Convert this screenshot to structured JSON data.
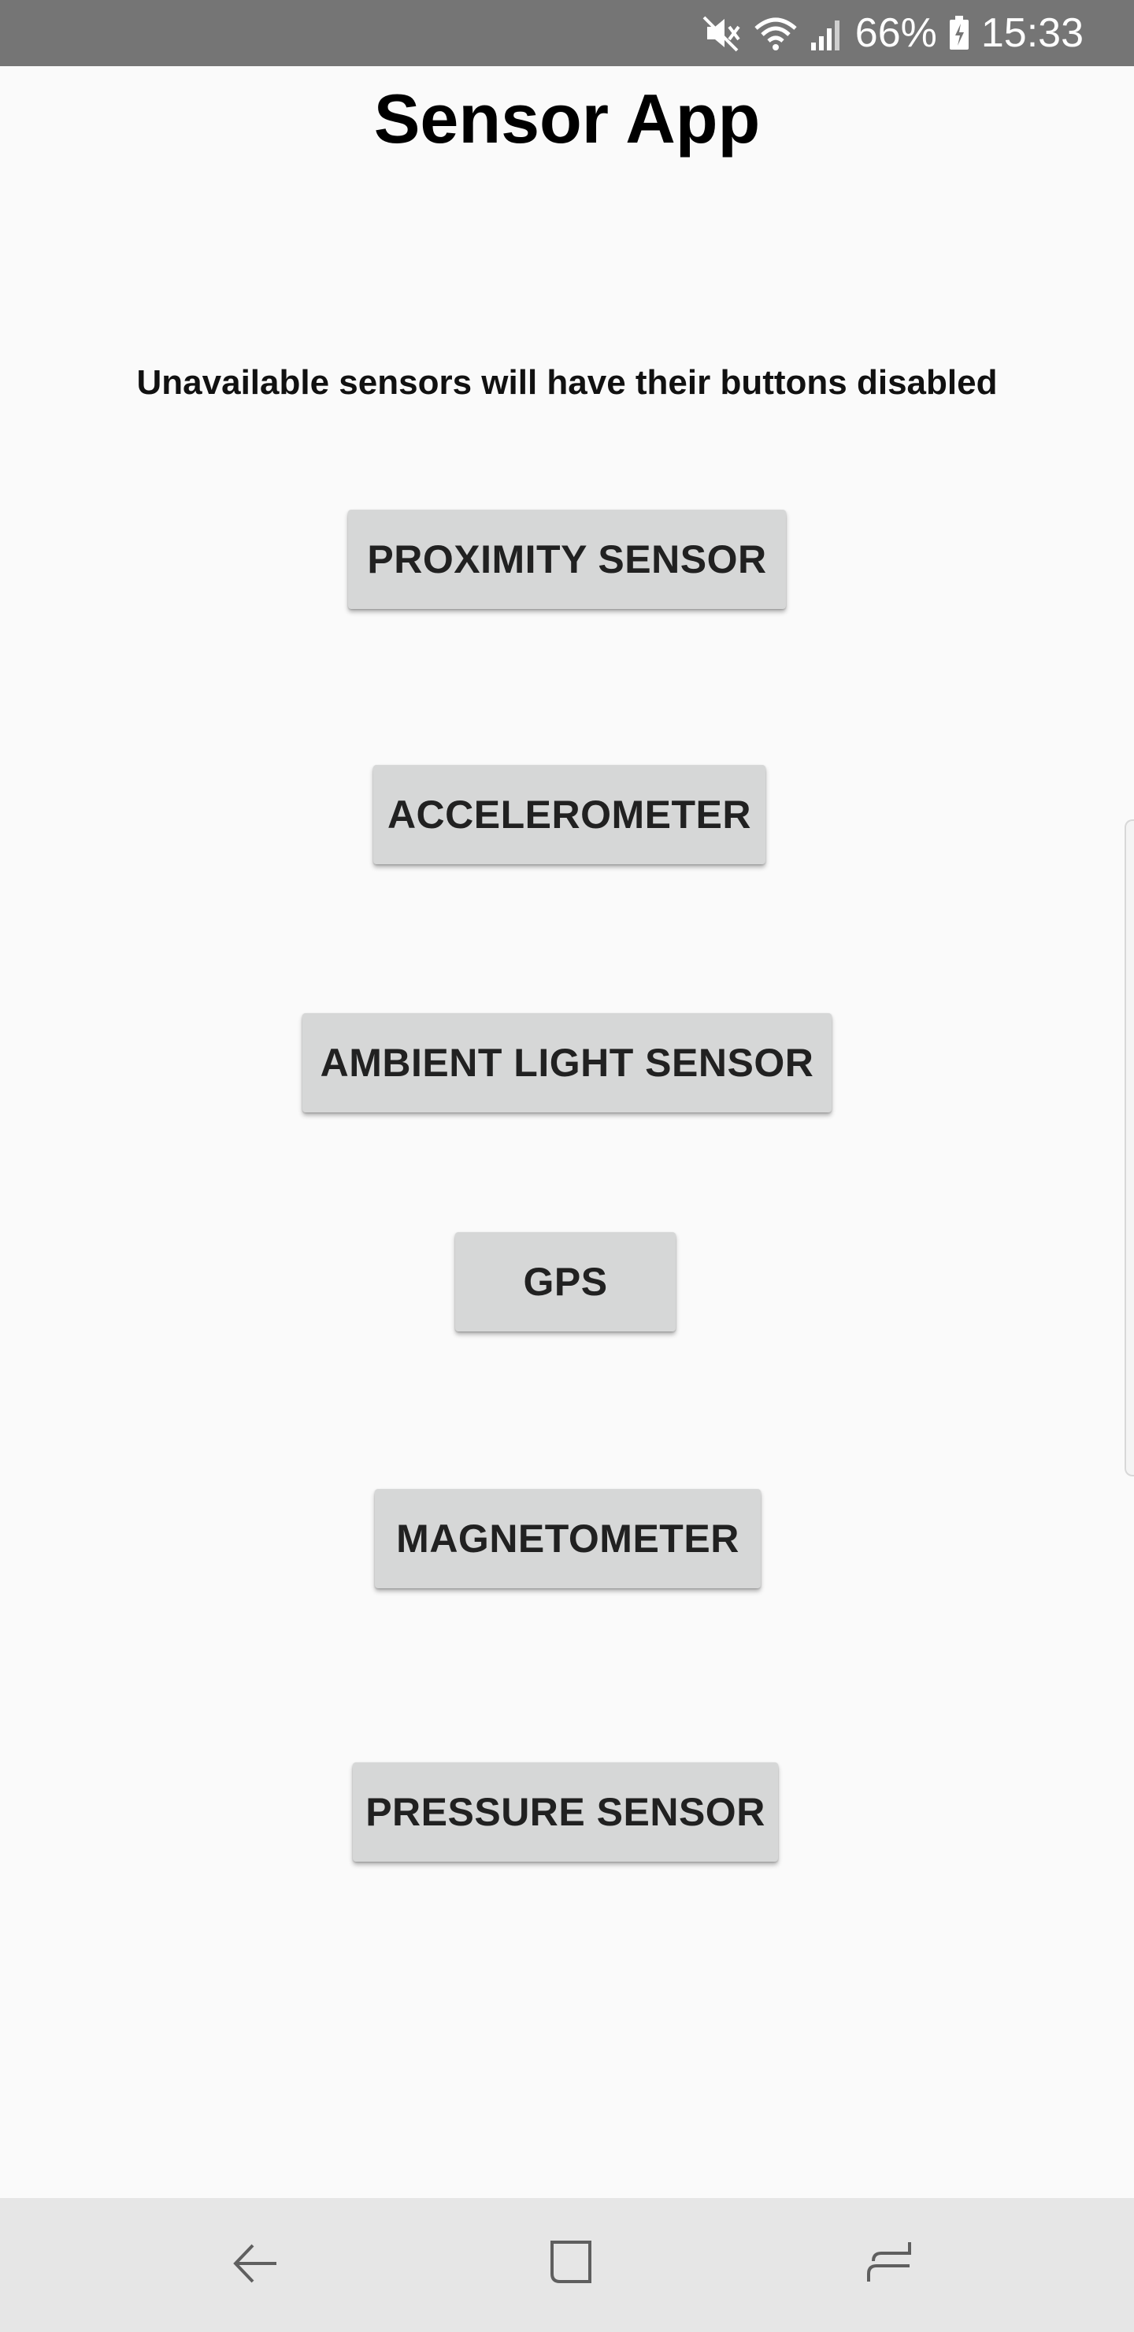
{
  "status_bar": {
    "battery_percent": "66%",
    "time": "15:33",
    "icons": [
      "mute-icon",
      "wifi-icon",
      "signal-icon",
      "battery-charging-icon"
    ]
  },
  "app": {
    "title": "Sensor App",
    "info": "Unavailable sensors will have their buttons disabled"
  },
  "buttons": {
    "proximity": "PROXIMITY SENSOR",
    "accelerometer": "ACCELEROMETER",
    "ambient_light": "AMBIENT LIGHT SENSOR",
    "gps": "GPS",
    "magnetometer": "MAGNETOMETER",
    "pressure": "PRESSURE SENSOR"
  },
  "nav_bar": {
    "icons": [
      "back-icon",
      "home-icon",
      "recent-apps-icon"
    ]
  },
  "colors": {
    "status_bar": "#757575",
    "background": "#fafafa",
    "button": "#d6d7d7",
    "nav_bar": "#e6e6e6"
  }
}
